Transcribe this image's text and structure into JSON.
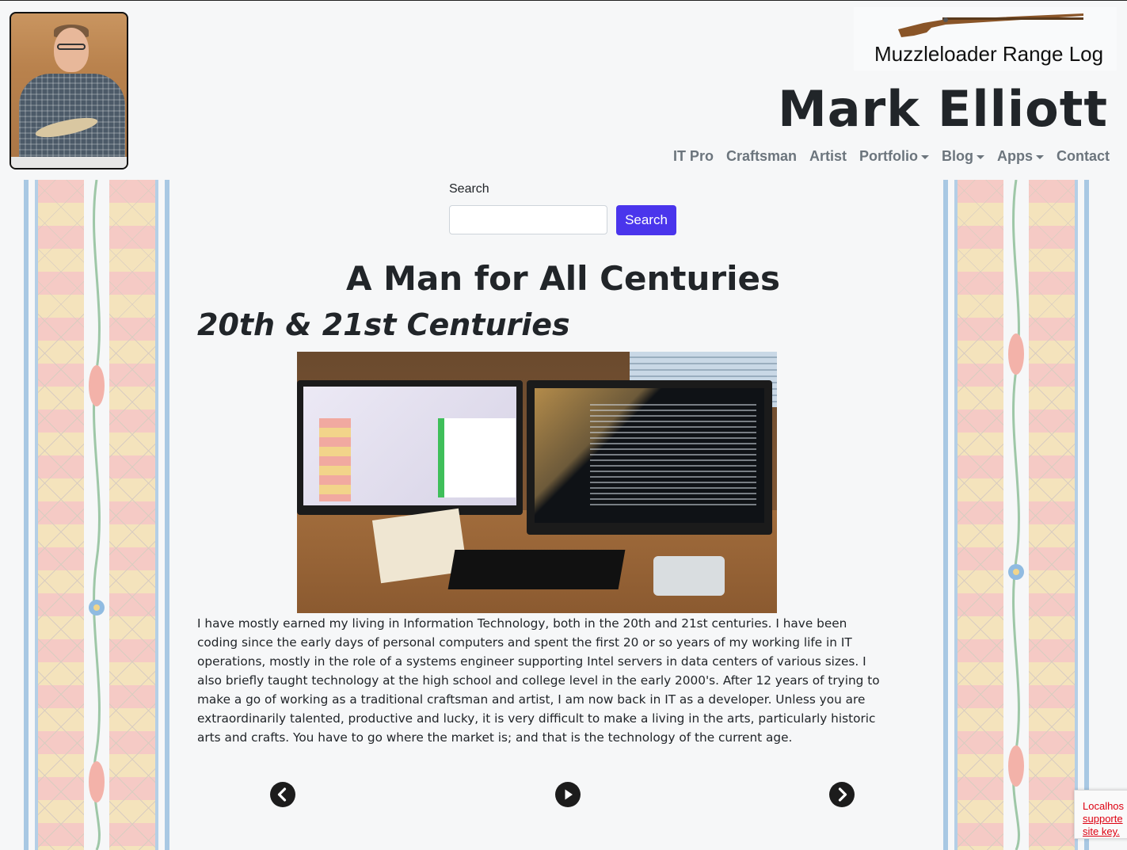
{
  "header": {
    "avatar_alt": "Mark Elliott portrait",
    "brand_text": "Muzzleloader Range Log",
    "site_name": "Mark Elliott",
    "nav": [
      {
        "label": "IT Pro",
        "dropdown": false
      },
      {
        "label": "Craftsman",
        "dropdown": false
      },
      {
        "label": "Artist",
        "dropdown": false
      },
      {
        "label": "Portfolio",
        "dropdown": true
      },
      {
        "label": "Blog",
        "dropdown": true
      },
      {
        "label": "Apps",
        "dropdown": true
      },
      {
        "label": "Contact",
        "dropdown": false
      }
    ]
  },
  "search": {
    "label": "Search",
    "value": "",
    "button_label": "Search"
  },
  "main": {
    "title": "A Man for All Centuries",
    "section_title": "20th & 21st Centuries",
    "body": "I have mostly earned my living in Information Technology, both in the 20th and 21st centuries. I have been coding since the early days of personal computers and spent the first 20 or so years of my working life in IT operations, mostly in the role of a systems engineer supporting Intel servers in data centers of various sizes. I also briefly taught technology at the high school and college level in the early 2000's. After 12 years of trying to make a go of working as a traditional craftsman and artist, I am now back in IT as a developer. Unless you are extraordinarily talented, productive and lucky, it is very difficult to make a living in the arts, particularly historic arts and crafts. You have to go where the market is; and that is the technology of the current age."
  },
  "carousel": {
    "prev_icon": "chevron-left-icon",
    "play_icon": "play-icon",
    "next_icon": "chevron-right-icon"
  },
  "recaptcha": {
    "line1": "Localhos",
    "line2": "supporte",
    "line3": "site key."
  },
  "colors": {
    "accent": "#4a35ec",
    "nav_text": "#6c757d",
    "heading": "#212529",
    "error": "#dd1111"
  }
}
